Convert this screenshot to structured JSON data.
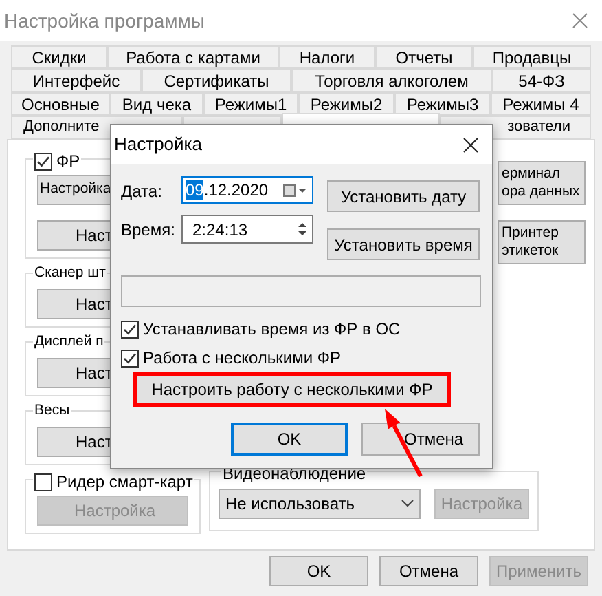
{
  "window": {
    "title": "Настройка программы"
  },
  "tab_rows": [
    [
      {
        "label": "Скидки",
        "selected": false
      },
      {
        "label": "Работа с картами",
        "selected": false
      },
      {
        "label": "Налоги",
        "selected": false
      },
      {
        "label": "Отчеты",
        "selected": false
      },
      {
        "label": "Продавцы",
        "selected": false
      }
    ],
    [
      {
        "label": "Интерфейс",
        "selected": false
      },
      {
        "label": "Сертификаты",
        "selected": false
      },
      {
        "label": "Торговля алкоголем",
        "selected": false
      },
      {
        "label": "54-ФЗ",
        "selected": false
      }
    ],
    [
      {
        "label": "Основные",
        "selected": false
      },
      {
        "label": "Вид чека",
        "selected": false
      },
      {
        "label": "Режимы1",
        "selected": false
      },
      {
        "label": "Режимы2",
        "selected": false
      },
      {
        "label": "Режимы3",
        "selected": false
      },
      {
        "label": "Режимы 4",
        "selected": false
      }
    ],
    [
      {
        "label": "Дополните",
        "selected": false
      },
      {
        "selected": false
      },
      {
        "selected": true
      },
      {
        "label": "зователи",
        "selected": false
      }
    ]
  ],
  "device_groups": [
    {
      "kind": "checkbox",
      "label": "ФР",
      "checked": true,
      "buttons": [
        {
          "label": "Настройка",
          "disabled": false
        },
        {
          "label": "Наст",
          "disabled": false
        }
      ]
    },
    {
      "kind": "plain",
      "label": "Сканер шт",
      "buttons": [
        {
          "label": "Наст",
          "disabled": false
        }
      ]
    },
    {
      "kind": "plain",
      "label": "Дисплей п",
      "buttons": [
        {
          "label": "Наст",
          "disabled": false
        }
      ]
    },
    {
      "kind": "plain",
      "label": "Весы",
      "buttons": [
        {
          "label": "Наст",
          "disabled": false
        }
      ]
    },
    {
      "kind": "checkbox",
      "label": "Ридер смарт-карт",
      "checked": false,
      "buttons": [
        {
          "label": "Настройка",
          "disabled": true
        }
      ]
    }
  ],
  "side_buttons": [
    {
      "lines": [
        "ерминал",
        "ора данных"
      ]
    },
    {
      "lines": [
        "Принтер",
        "этикеток"
      ]
    }
  ],
  "video": {
    "label": "Видеонаблюдение",
    "select": "Не использовать",
    "button": {
      "label": "Настройка",
      "disabled": true
    }
  },
  "footer_buttons": [
    {
      "label": "OK",
      "disabled": false
    },
    {
      "label": "Отмена",
      "disabled": false
    },
    {
      "label": "Применить",
      "disabled": true
    }
  ],
  "dialog": {
    "title": "Настройка",
    "date_label": "Дата:",
    "date_selected_part": "09",
    "date_rest": ".12.2020",
    "time_label": "Время:",
    "time_value": "2:24:13",
    "set_date": "Установить дату",
    "set_time": "Установить время",
    "checkboxes": [
      {
        "label": "Устанавливать время из ФР в ОС",
        "checked": true
      },
      {
        "label": "Работа с несколькими ФР",
        "checked": true
      }
    ],
    "multi_button": {
      "label": "Настроить работу с несколькими ФР",
      "highlighted": true
    },
    "ok": "OK",
    "cancel": "Отмена"
  }
}
